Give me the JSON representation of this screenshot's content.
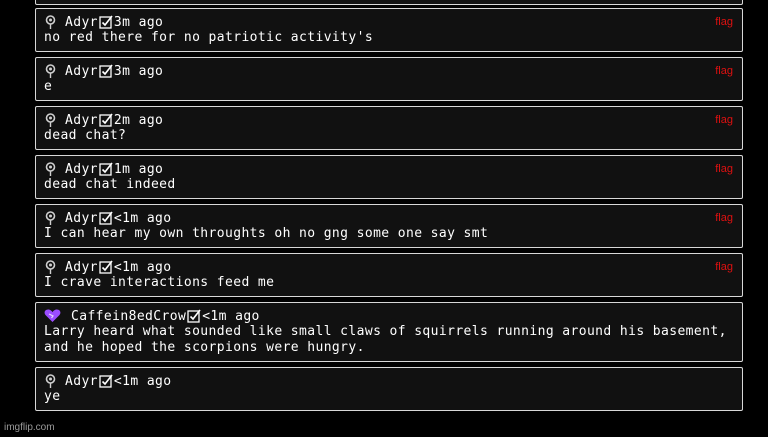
{
  "messages": [
    {
      "avatar_icon": "map-pin-icon",
      "username": "Adyr",
      "time": "3m ago",
      "text": "no red there for no patriotic activity's",
      "flag": "flag"
    },
    {
      "avatar_icon": "map-pin-icon",
      "username": "Adyr",
      "time": "3m ago",
      "text": "e",
      "flag": "flag"
    },
    {
      "avatar_icon": "map-pin-icon",
      "username": "Adyr",
      "time": "2m ago",
      "text": "dead chat?",
      "flag": "flag"
    },
    {
      "avatar_icon": "map-pin-icon",
      "username": "Adyr",
      "time": "1m ago",
      "text": "dead chat indeed",
      "flag": "flag"
    },
    {
      "avatar_icon": "map-pin-icon",
      "username": "Adyr",
      "time": "<1m ago",
      "text": "I can hear my own throughts oh no gng some one say smt",
      "flag": "flag"
    },
    {
      "avatar_icon": "map-pin-icon",
      "username": "Adyr",
      "time": "<1m ago",
      "text": "I crave interactions feed me",
      "flag": "flag"
    },
    {
      "avatar_icon": "purple-heart-icon",
      "username": "Caffein8edCrow",
      "time": "<1m ago",
      "text": "Larry heard what sounded like small claws of squirrels running around his basement, and he hoped the scorpions were hungry.",
      "flag": ""
    },
    {
      "avatar_icon": "map-pin-icon",
      "username": "Adyr",
      "time": "<1m ago",
      "text": "ye",
      "flag": ""
    }
  ],
  "watermark": "imgflip.com",
  "colors": {
    "background": "#000000",
    "card": "#111111",
    "border": "#d8d8d8",
    "flag": "#dd1111",
    "heart": "#9b4dff"
  }
}
